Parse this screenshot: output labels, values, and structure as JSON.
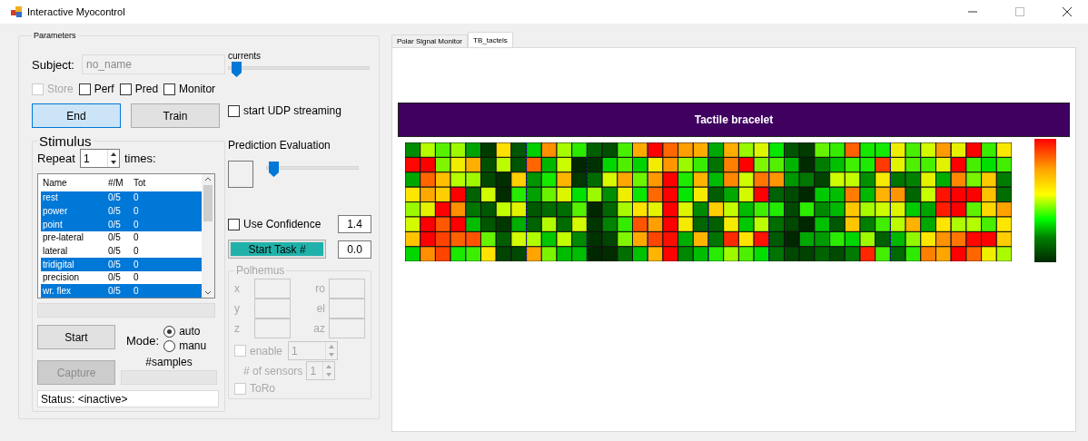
{
  "window": {
    "title": "Interactive Myocontrol"
  },
  "parameters": {
    "title": "Parameters",
    "subject": {
      "label": "Subject:",
      "placeholder": "no_name"
    },
    "currents": {
      "label": "currents",
      "level": 0.03
    },
    "checkboxes": [
      {
        "label": "Store",
        "checked": false,
        "disabled": true
      },
      {
        "label": "Perf",
        "checked": false,
        "disabled": false
      },
      {
        "label": "Pred",
        "checked": false,
        "disabled": false
      },
      {
        "label": "Monitor",
        "checked": false,
        "disabled": false
      }
    ],
    "buttons": [
      {
        "label": "End",
        "focused": true
      },
      {
        "label": "Train",
        "focused": false
      }
    ],
    "udp": {
      "label": "start UDP streaming",
      "checked": false
    },
    "stimulus": {
      "title": "Stimulus",
      "repeat_label": "Repeat",
      "repeat_value": "1",
      "times_label": "times:",
      "columns": [
        "Name",
        "#/M",
        "Tot"
      ],
      "rows": [
        {
          "cells": [
            "rest",
            "0/5",
            "0"
          ],
          "selected": true
        },
        {
          "cells": [
            "power",
            "0/5",
            "0"
          ],
          "selected": true
        },
        {
          "cells": [
            "point",
            "0/5",
            "0"
          ],
          "selected": true
        },
        {
          "cells": [
            "pre-lateral",
            "0/5",
            "0"
          ],
          "selected": false
        },
        {
          "cells": [
            "lateral",
            "0/5",
            "0"
          ],
          "selected": false
        },
        {
          "cells": [
            "tridigital",
            "0/5",
            "0"
          ],
          "selected": true
        },
        {
          "cells": [
            "precision",
            "0/5",
            "0"
          ],
          "selected": false
        },
        {
          "cells": [
            "wr. flex",
            "0/5",
            "0"
          ],
          "selected": true
        }
      ],
      "start": {
        "label": "Start",
        "disabled": false
      },
      "mode_label": "Mode:",
      "modes": [
        {
          "label": "auto",
          "selected": true
        },
        {
          "label": "manu",
          "selected": false
        }
      ],
      "capture": {
        "label": "Capture",
        "disabled": true
      },
      "samples_label": "#samples",
      "status": "Status: <inactive>"
    },
    "prediction": {
      "title": "Prediction Evaluation",
      "level": 0.03
    },
    "confidence": {
      "label": "Use Confidence",
      "checked": false,
      "value": "1.4"
    },
    "task": {
      "label": "Start Task #",
      "value": "0.0"
    },
    "polhemus": {
      "title": "Polhemus",
      "disabled": true,
      "fields": [
        {
          "label": "x"
        },
        {
          "label": "ro"
        },
        {
          "label": "y"
        },
        {
          "label": "el"
        },
        {
          "label": "z"
        },
        {
          "label": "az"
        }
      ],
      "enable": {
        "label": "enable",
        "checked": false,
        "value": "1"
      },
      "sensors": {
        "label": "# of sensors",
        "value": "1"
      },
      "toro": {
        "label": "ToRo",
        "checked": false
      }
    }
  },
  "tabs": [
    {
      "label": "Polar Signal Monitor",
      "selected": false
    },
    {
      "label": "TB_tactels",
      "selected": true
    }
  ],
  "panel": {
    "banner": "Tactile bracelet"
  }
}
